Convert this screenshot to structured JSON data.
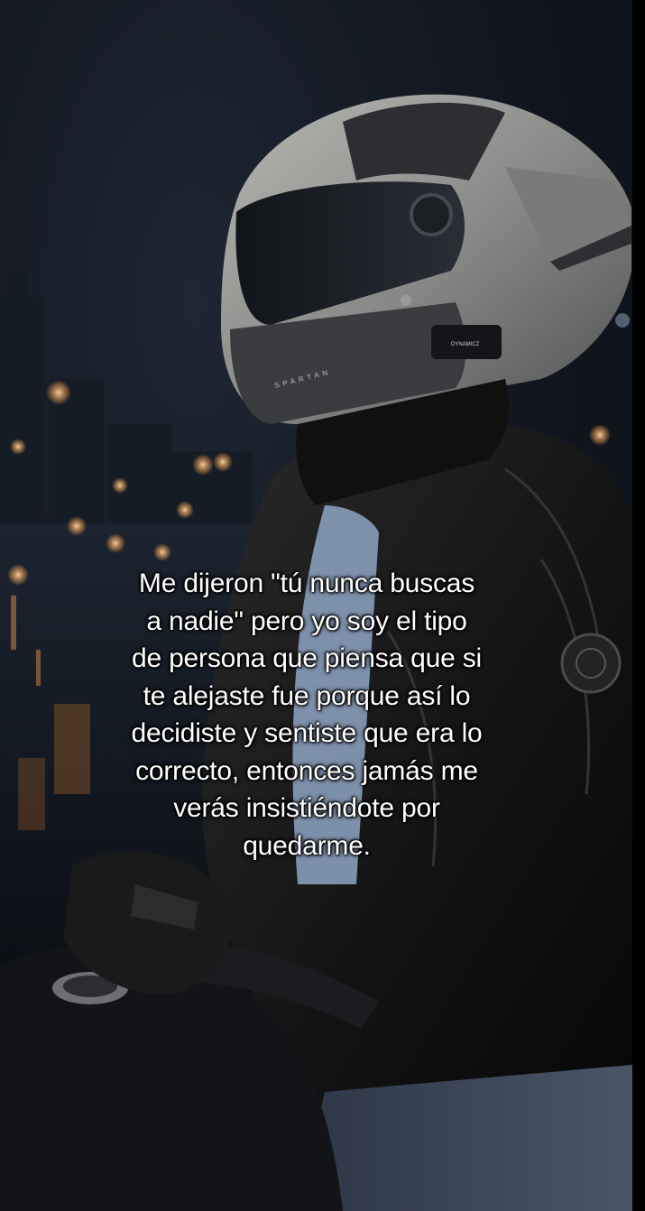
{
  "caption": {
    "lines": [
      "Me dijeron \"tú nunca buscas",
      "a nadie\" pero yo soy el tipo",
      "de persona que piensa que si",
      "te alejaste fue porque así lo",
      "decidiste y sentiste que era lo",
      "correcto, entonces jamás me",
      "verás insistiéndote por",
      "quedarme."
    ]
  },
  "helmet": {
    "brand_top": "DYNAMICZ",
    "brand_side": "SPARTAN"
  },
  "colors": {
    "caption_text": "#ffffff",
    "background": "#0d1016",
    "helmet_shell": "#8e8e8c",
    "jacket": "#151515",
    "shirt": "#8fa6c4",
    "city_light": "#f4b77a"
  }
}
